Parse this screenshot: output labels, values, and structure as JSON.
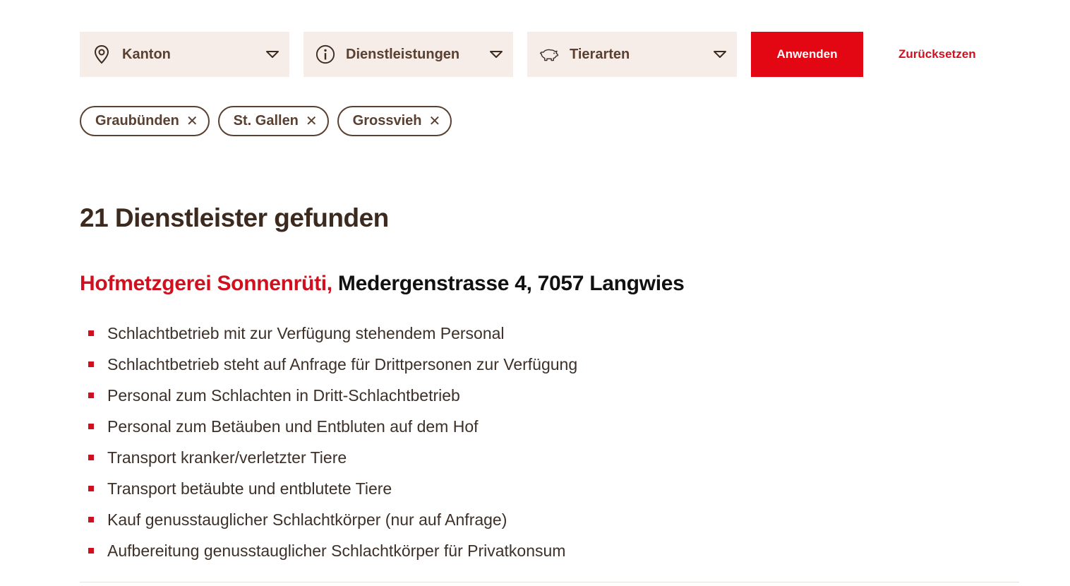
{
  "filters": {
    "kanton_label": "Kanton",
    "dienstleistungen_label": "Dienstleistungen",
    "tierarten_label": "Tierarten",
    "apply_label": "Anwenden",
    "reset_label": "Zurücksetzen"
  },
  "active_filters": [
    "Graubünden",
    "St. Gallen",
    "Grossvieh"
  ],
  "results": {
    "title": "21 Dienstleister gefunden"
  },
  "provider": {
    "name": "Hofmetzgerei Sonnenrüti,",
    "address": "Medergenstrasse 4, 7057 Langwies",
    "services": [
      "Schlachtbetrieb mit zur Verfügung stehendem Personal",
      "Schlachtbetrieb steht auf Anfrage für Drittpersonen zur Verfügung",
      "Personal zum Schlachten in Dritt-Schlachtbetrieb",
      "Personal zum Betäuben und Entbluten auf dem Hof",
      "Transport kranker/verletzter Tiere",
      "Transport betäubte und entblutete Tiere",
      "Kauf genusstauglicher Schlachtkörper (nur auf Anfrage)",
      "Aufbereitung genusstauglicher Schlachtkörper für Privatkonsum"
    ]
  },
  "colors": {
    "accent": "#e30613",
    "dropdown_bg": "#f6ede9",
    "text_brown": "#5a4030"
  }
}
